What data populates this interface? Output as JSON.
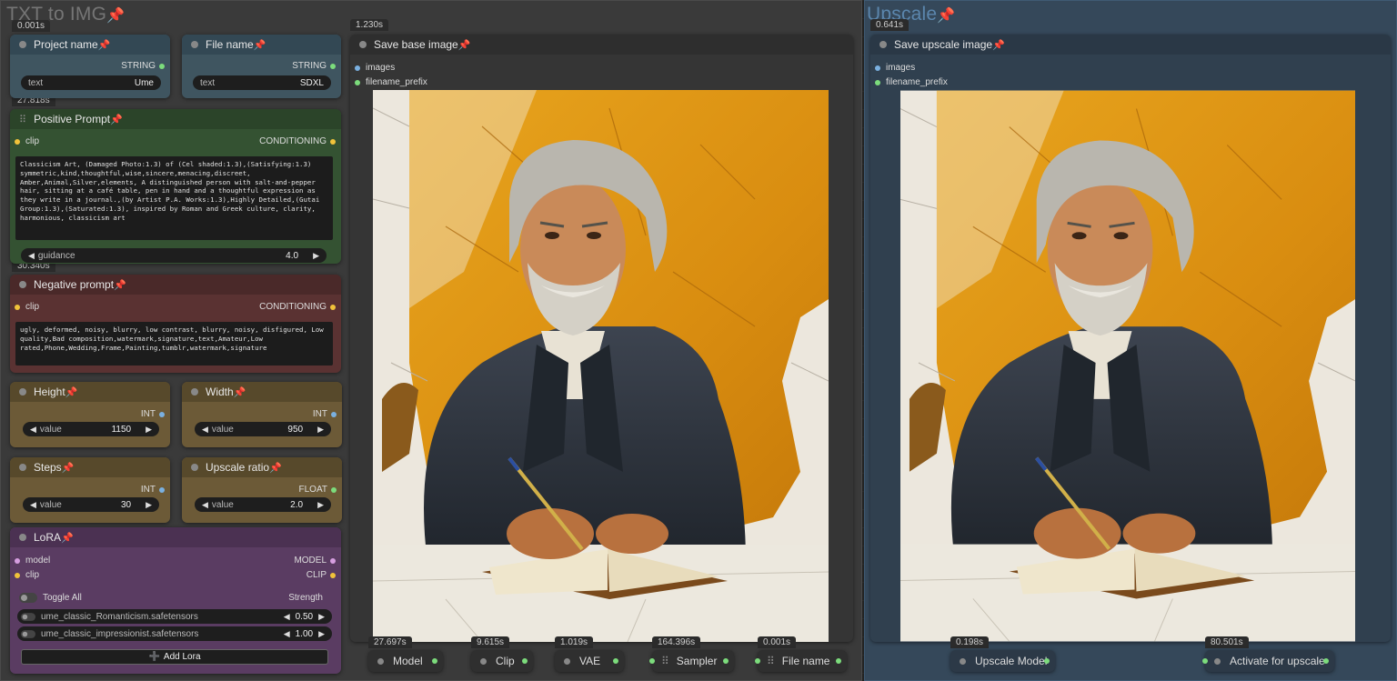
{
  "groups": {
    "left_title": "TXT to IMG",
    "right_title": "Upscale"
  },
  "timings": {
    "project": "0.001s",
    "positive": "27.818s",
    "negative": "30.340s",
    "save_base": "1.230s",
    "save_upscale": "0.641s",
    "model": "27.697s",
    "clip": "9.615s",
    "vae": "1.019s",
    "sampler": "164.396s",
    "file_name": "0.001s",
    "upscale_model": "0.198s",
    "activate": "80.501s"
  },
  "project_node": {
    "title": "Project name",
    "out_label": "STRING",
    "widget_label": "text",
    "widget_value": "Ume"
  },
  "file_node": {
    "title": "File name",
    "out_label": "STRING",
    "widget_label": "text",
    "widget_value": "SDXL"
  },
  "positive_node": {
    "title": "Positive Prompt",
    "in_label": "clip",
    "out_label": "CONDITIONING",
    "text": "Classicism Art, (Damaged Photo:1.3) of (Cel shaded:1.3),(Satisfying:1.3) symmetric,kind,thoughtful,wise,sincere,menacing,discreet, Amber,Animal,Silver,elements, A distinguished person with salt-and-pepper hair, sitting at a café table, pen in hand and a thoughtful expression as they write in a journal.,(by Artist P.A. Works:1.3),Highly Detailed,(Gutai Group:1.3),(Saturated:1.3), inspired by Roman and Greek culture, clarity, harmonious, classicism art",
    "guidance_label": "guidance",
    "guidance_value": "4.0"
  },
  "negative_node": {
    "title": "Negative prompt",
    "in_label": "clip",
    "out_label": "CONDITIONING",
    "text": "ugly, deformed, noisy, blurry, low contrast, blurry, noisy, disfigured, Low quality,Bad composition,watermark,signature,text,Amateur,Low rated,Phone,Wedding,Frame,Painting,tumblr,watermark,signature"
  },
  "height_node": {
    "title": "Height",
    "out_label": "INT",
    "widget_label": "value",
    "widget_value": "1150"
  },
  "width_node": {
    "title": "Width",
    "out_label": "INT",
    "widget_label": "value",
    "widget_value": "950"
  },
  "steps_node": {
    "title": "Steps",
    "out_label": "INT",
    "widget_label": "value",
    "widget_value": "30"
  },
  "upscale_ratio_node": {
    "title": "Upscale ratio",
    "out_label": "FLOAT",
    "widget_label": "value",
    "widget_value": "2.0"
  },
  "lora_node": {
    "title": "LoRA",
    "in_model": "model",
    "in_clip": "clip",
    "out_model": "MODEL",
    "out_clip": "CLIP",
    "toggle_all": "Toggle All",
    "strength_label": "Strength",
    "loras": [
      {
        "name": "ume_classic_Romanticism.safetensors",
        "strength": "0.50"
      },
      {
        "name": "ume_classic_impressionist.safetensors",
        "strength": "1.00"
      }
    ],
    "add_label": "Add Lora"
  },
  "save_base_node": {
    "title": "Save base image",
    "in_images": "images",
    "in_prefix": "filename_prefix"
  },
  "save_upscale_node": {
    "title": "Save upscale image",
    "in_images": "images",
    "in_prefix": "filename_prefix"
  },
  "bottom_nodes": {
    "model": "Model",
    "clip": "Clip",
    "vae": "VAE",
    "sampler": "Sampler",
    "file_name": "File name",
    "upscale_model": "Upscale Model",
    "activate": "Activate for upscale"
  },
  "colors": {
    "accent_pin": "#e04848",
    "string_socket": "#7cdc7c",
    "conditioning_socket": "#f0c23a",
    "int_socket": "#7ab0e0"
  },
  "icons": [
    "pin-icon",
    "node-dot-icon",
    "grip-icon",
    "arrow-left-icon",
    "arrow-right-icon",
    "plus-icon",
    "toggle-icon"
  ]
}
